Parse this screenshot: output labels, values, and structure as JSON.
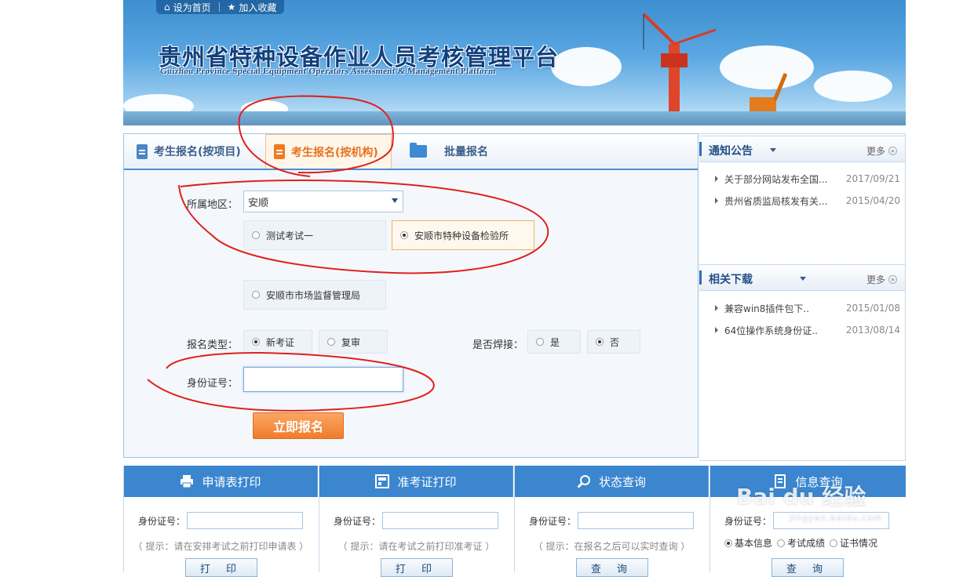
{
  "header": {
    "top_links": [
      "设为首页",
      "加入收藏"
    ],
    "title": "贵州省特种设备作业人员考核管理平台",
    "subtitle": "Guizhou Province Special Equipment Operators Assessment & Management Platform"
  },
  "tabs": [
    {
      "label": "考生报名(按项目)",
      "active": false
    },
    {
      "label": "考生报名(按机构)",
      "active": true
    },
    {
      "label": "批量报名",
      "active": false
    }
  ],
  "form": {
    "region_label": "所属地区：",
    "region_value": "安顺",
    "institutions": [
      {
        "label": "测试考试一",
        "selected": false
      },
      {
        "label": "安顺市特种设备检验所",
        "selected": true
      },
      {
        "label": "安顺市市场监督管理局",
        "selected": false
      }
    ],
    "type_label": "报名类型：",
    "type_options": [
      {
        "label": "新考证",
        "selected": true
      },
      {
        "label": "复审",
        "selected": false
      }
    ],
    "weld_label": "是否焊接：",
    "weld_options": [
      {
        "label": "是",
        "selected": false
      },
      {
        "label": "否",
        "selected": true
      }
    ],
    "id_label": "身份证号：",
    "id_value": "",
    "submit_label": "立即报名"
  },
  "sidebar": {
    "notices": {
      "title": "通知公告",
      "more": "更多",
      "items": [
        {
          "title": "关于部分网站发布全国...",
          "date": "2017/09/21"
        },
        {
          "title": "贵州省质监局核发有关...",
          "date": "2015/04/20"
        }
      ]
    },
    "downloads": {
      "title": "相关下载",
      "more": "更多",
      "items": [
        {
          "title": "兼容win8插件包下..",
          "date": "2015/01/08"
        },
        {
          "title": "64位操作系统身份证..",
          "date": "2013/08/14"
        }
      ]
    }
  },
  "panels": [
    {
      "title": "申请表打印",
      "id_label": "身份证号：",
      "hint": "（ 提示：请在安排考试之前打印申请表 ）",
      "button": "打 印"
    },
    {
      "title": "准考证打印",
      "id_label": "身份证号：",
      "hint": "（ 提示：请在考试之前打印准考证 ）",
      "button": "打 印"
    },
    {
      "title": "状态查询",
      "id_label": "身份证号：",
      "hint": "（ 提示：在报名之后可以实时查询 ）",
      "button": "查 询"
    },
    {
      "title": "信息查询",
      "id_label": "身份证号：",
      "radios": [
        "基本信息",
        "考试成绩",
        "证书情况"
      ],
      "button": "查 询"
    }
  ],
  "watermark": {
    "brand": "Bai  du 经验",
    "url": "jingyan.baidu.com"
  },
  "colors": {
    "accent_blue": "#3b86cf",
    "accent_orange": "#f07c2c",
    "annotation_red": "#e0201b"
  }
}
